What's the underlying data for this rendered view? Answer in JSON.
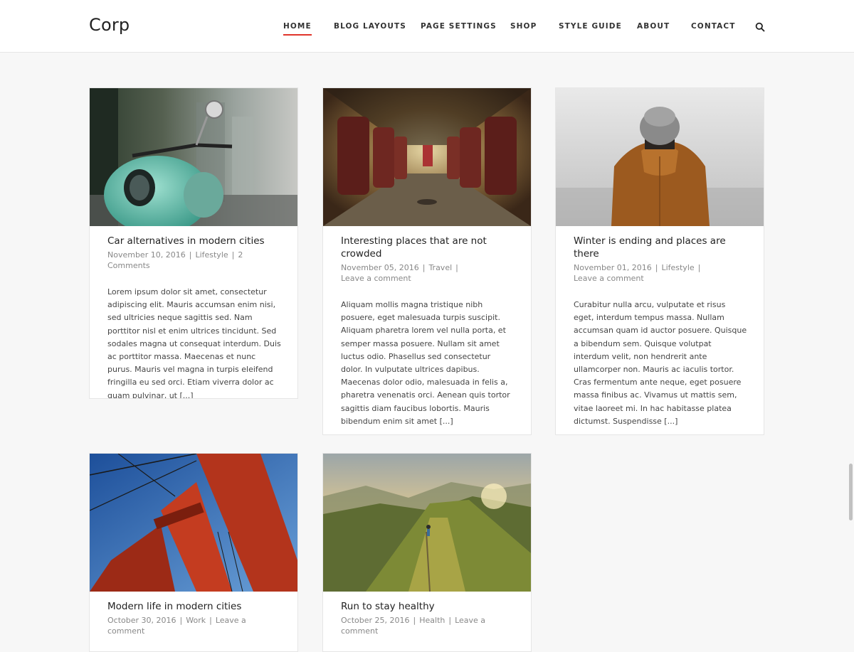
{
  "header": {
    "logo": "Corp",
    "nav": [
      {
        "label": "HOME",
        "active": true
      },
      {
        "label": "BLOG LAYOUTS"
      },
      {
        "label": "PAGE SETTINGS"
      },
      {
        "label": "SHOP"
      },
      {
        "label": "STYLE GUIDE"
      },
      {
        "label": "ABOUT"
      },
      {
        "label": "CONTACT"
      }
    ],
    "search_icon": "search-icon"
  },
  "posts": [
    {
      "title": "Car alternatives in modern cities",
      "date": "November 10, 2016",
      "category": "Lifestyle",
      "comments": "2 Comments",
      "excerpt": "Lorem ipsum dolor sit amet, consectetur adipiscing elit. Mauris accumsan enim nisi, sed ultricies neque sagittis sed. Nam porttitor nisl et enim ultrices tincidunt. Sed sodales magna ut consequat interdum. Duis ac porttitor massa. Maecenas et nunc purus. Mauris vel magna in turpis eleifend fringilla eu sed orci. Etiam viverra dolor ac quam pulvinar, ut [...]",
      "image": "teal scooter on street"
    },
    {
      "title": "Interesting places that are not crowded",
      "date": "November 05, 2016",
      "category": "Travel",
      "comments": "Leave a comment",
      "excerpt": "Aliquam mollis magna tristique nibh posuere, eget malesuada turpis suscipit. Aliquam pharetra lorem vel nulla porta, et semper massa posuere. Nullam sit amet luctus odio. Phasellus sed consectetur dolor. In vulputate ultrices dapibus. Maecenas dolor odio, malesuada in felis a, pharetra venenatis orci. Aenean quis tortor sagittis diam faucibus lobortis. Mauris bibendum enim sit amet [...]",
      "image": "empty tram interior"
    },
    {
      "title": "Winter is ending and places are there",
      "date": "November 01, 2016",
      "category": "Lifestyle",
      "comments": "Leave a comment",
      "excerpt": "Curabitur nulla arcu, vulputate et risus eget, interdum tempus massa. Nullam accumsan quam id auctor posuere. Quisque a bibendum sem. Quisque volutpat interdum velit, non hendrerit ante ullamcorper non. Mauris ac iaculis tortor. Cras fermentum ante neque, eget posuere massa finibus ac. Vivamus ut mattis sem, vitae laoreet mi. In hac habitasse platea dictumst. Suspendisse [...]",
      "image": "person in hood and beanie in fog"
    },
    {
      "title": "Modern life in modern cities",
      "date": "October 30, 2016",
      "category": "Work",
      "comments": "Leave a comment",
      "excerpt": "",
      "image": "red bridge tower against blue sky"
    },
    {
      "title": "Run to stay healthy",
      "date": "October 25, 2016",
      "category": "Health",
      "comments": "Leave a comment",
      "excerpt": "",
      "image": "runner on mountain ridge at sunset"
    }
  ],
  "colors": {
    "accent": "#e0352b",
    "background": "#f7f7f7",
    "card": "#ffffff",
    "meta_text": "#888888",
    "title_text": "#222222"
  }
}
